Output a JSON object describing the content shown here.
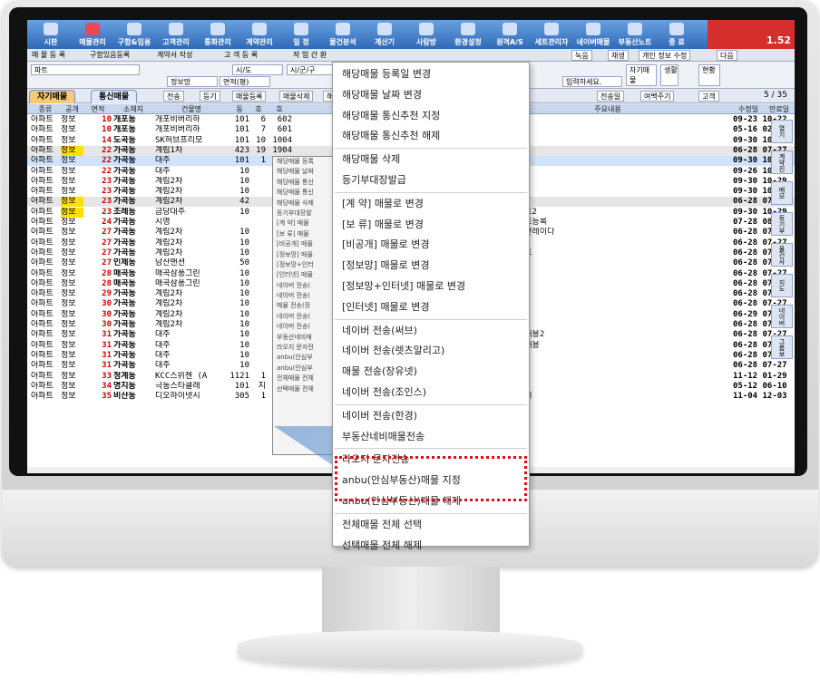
{
  "titlebar": {
    "items": [
      {
        "label": "시판"
      },
      {
        "label": "매물관리"
      },
      {
        "label": "구함&임용"
      },
      {
        "label": "고객관리"
      },
      {
        "label": "통화관리"
      },
      {
        "label": "계약관리"
      },
      {
        "label": "일 정"
      },
      {
        "label": "물건분석"
      },
      {
        "label": "계산기"
      },
      {
        "label": "사람방"
      },
      {
        "label": "환경설정"
      },
      {
        "label": "원격A/S"
      },
      {
        "label": "세트관리자"
      },
      {
        "label": "네이버매물"
      },
      {
        "label": "부동산노트"
      },
      {
        "label": "종 료"
      }
    ],
    "right_text": "1.52"
  },
  "toolbar1": {
    "items": [
      "매 물 등 록",
      "구함있음등록",
      "계약서 작성",
      "고 객 등 록",
      "작 업 간 환"
    ],
    "right_items": [
      "녹음",
      "재생",
      "개인 정보 수정",
      "다음"
    ]
  },
  "toolbar2": {
    "field1": "파트",
    "select1": "시/도",
    "select2": "시/군/구",
    "checkbox": "정보망",
    "select3": "면적(평)",
    "hint": "입력하세요.",
    "btn1": "자기매물",
    "btn2": "생활",
    "btn3": "현황"
  },
  "tabs": [
    {
      "label": "자기매물"
    },
    {
      "label": "통신매물"
    }
  ],
  "toolbar3": {
    "items": [
      "전송",
      "등기",
      "매물등록",
      "매물삭제",
      "해제요"
    ],
    "right_items": [
      "전송일",
      "여백주기",
      "고객"
    ],
    "page": "5 / 35"
  },
  "table": {
    "headers": [
      "종류",
      "공개",
      "면적",
      "소재지",
      "건물명",
      "동",
      "호",
      "호",
      "주요내용",
      "수정일",
      "만료일"
    ],
    "rows": [
      {
        "type": "아파트",
        "kind": "정보",
        "area": "10",
        "loc": "개포동",
        "bld": "개포비버리하",
        "dong": "101",
        "ho": "6",
        "unit": "602",
        "desc": "",
        "date": "09-23 10-22"
      },
      {
        "type": "아파트",
        "kind": "정보",
        "area": "10",
        "loc": "개포동",
        "bld": "개포비버리하",
        "dong": "101",
        "ho": "7",
        "unit": "601",
        "desc": "",
        "date": "05-16 02-10"
      },
      {
        "type": "아파트",
        "kind": "정보",
        "area": "14",
        "loc": "도곡동",
        "bld": "SK허브프리모",
        "dong": "101",
        "ho": "10",
        "unit": "1004",
        "desc": "",
        "date": "09-30 10-29"
      },
      {
        "type": "아파트",
        "kind": "정보",
        "area": "22",
        "loc": "가곡동",
        "bld": "계림1차",
        "dong": "423",
        "ho": "19",
        "unit": "1904",
        "desc": "",
        "date": "06-28 07-27"
      },
      {
        "type": "아파트",
        "kind": "정보",
        "area": "22",
        "loc": "가곡동",
        "bld": "대주",
        "dong": "101",
        "ho": "1",
        "unit": "101",
        "desc": "",
        "date": "09-30 10-29"
      },
      {
        "type": "아파트",
        "kind": "정보",
        "area": "22",
        "loc": "가곡동",
        "bld": "대주",
        "dong": "10",
        "ho": "",
        "unit": "",
        "desc": "",
        "date": "09-26 10-25"
      },
      {
        "type": "아파트",
        "kind": "정보",
        "area": "23",
        "loc": "가곡동",
        "bld": "계림2차",
        "dong": "10",
        "ho": "",
        "unit": "",
        "desc": "",
        "date": "09-30 10-29"
      },
      {
        "type": "아파트",
        "kind": "정보",
        "area": "23",
        "loc": "가곡동",
        "bld": "계림2차",
        "dong": "10",
        "ho": "",
        "unit": "",
        "desc": "",
        "date": "09-30 10-29"
      },
      {
        "type": "아파트",
        "kind": "정보",
        "area": "23",
        "loc": "가곡동",
        "bld": "계림2차",
        "dong": "42",
        "ho": "",
        "unit": "",
        "desc": "",
        "date": "06-28 07-27"
      },
      {
        "type": "아파트",
        "kind": "정보",
        "area": "23",
        "loc": "조례동",
        "bld": "금당대주",
        "dong": "10",
        "ho": "",
        "unit": "",
        "desc": "스트2",
        "date": "09-30 10-29"
      },
      {
        "type": "아파트",
        "kind": "정보",
        "area": "24",
        "loc": "가곡동",
        "bld": "시영",
        "dong": "",
        "ho": "",
        "unit": "",
        "desc": "스트등록",
        "date": "07-28 08-26"
      },
      {
        "type": "아파트",
        "kind": "정보",
        "area": "27",
        "loc": "가곡동",
        "bld": "계림2차",
        "dong": "10",
        "ho": "",
        "unit": "",
        "desc": "동산레이다",
        "date": "06-28 07-27"
      },
      {
        "type": "아파트",
        "kind": "정보",
        "area": "27",
        "loc": "가곡동",
        "bld": "계림2차",
        "dong": "10",
        "ho": "",
        "unit": "",
        "desc": "",
        "date": "06-28 07-27"
      },
      {
        "type": "아파트",
        "kind": "정보",
        "area": "27",
        "loc": "가곡동",
        "bld": "계림2차",
        "dong": "10",
        "ho": "",
        "unit": "",
        "desc": "스트",
        "date": "06-28 07-27"
      },
      {
        "type": "아파트",
        "kind": "정보",
        "area": "27",
        "loc": "인제동",
        "bld": "남산맨션",
        "dong": "50",
        "ho": "",
        "unit": "",
        "desc": "",
        "date": "06-28 07-27"
      },
      {
        "type": "아파트",
        "kind": "정보",
        "area": "28",
        "loc": "매곡동",
        "bld": "매곡삼풍그린",
        "dong": "10",
        "ho": "",
        "unit": "",
        "desc": "",
        "date": "06-28 07-27"
      },
      {
        "type": "아파트",
        "kind": "정보",
        "area": "28",
        "loc": "매곡동",
        "bld": "매곡삼풍그린",
        "dong": "10",
        "ho": "",
        "unit": "",
        "desc": "",
        "date": "06-28 07-27"
      },
      {
        "type": "아파트",
        "kind": "정보",
        "area": "29",
        "loc": "가곡동",
        "bld": "계림2차",
        "dong": "10",
        "ho": "",
        "unit": "",
        "desc": "",
        "date": "06-28 07-27"
      },
      {
        "type": "아파트",
        "kind": "정보",
        "area": "30",
        "loc": "가곡동",
        "bld": "계림2차",
        "dong": "10",
        "ho": "",
        "unit": "",
        "desc": "",
        "date": "06-28 07-27"
      },
      {
        "type": "아파트",
        "kind": "정보",
        "area": "30",
        "loc": "가곡동",
        "bld": "계림2차",
        "dong": "10",
        "ho": "",
        "unit": "",
        "desc": "",
        "date": "06-29 07-28"
      },
      {
        "type": "아파트",
        "kind": "정보",
        "area": "30",
        "loc": "가곡동",
        "bld": "계림2차",
        "dong": "10",
        "ho": "",
        "unit": "",
        "desc": "",
        "date": "06-28 07-27"
      },
      {
        "type": "아파트",
        "kind": "정보",
        "area": "31",
        "loc": "가곡동",
        "bld": "대주",
        "dong": "10",
        "ho": "",
        "unit": "",
        "desc": "요내용2",
        "date": "06-28 07-27"
      },
      {
        "type": "아파트",
        "kind": "정보",
        "area": "31",
        "loc": "가곡동",
        "bld": "대주",
        "dong": "10",
        "ho": "",
        "unit": "",
        "desc": "요내용",
        "date": "06-28 07-27"
      },
      {
        "type": "아파트",
        "kind": "정보",
        "area": "31",
        "loc": "가곡동",
        "bld": "대주",
        "dong": "10",
        "ho": "",
        "unit": "",
        "desc": "",
        "date": "06-28 07-27"
      },
      {
        "type": "아파트",
        "kind": "정보",
        "area": "31",
        "loc": "가곡동",
        "bld": "대주",
        "dong": "10",
        "ho": "",
        "unit": "",
        "desc": "",
        "date": "06-28 07-27"
      },
      {
        "type": "아파트",
        "kind": "정보",
        "area": "33",
        "loc": "청계동",
        "bld": "KCC스위첸 (A",
        "dong": "1121",
        "ho": "1",
        "unit": "101",
        "desc": "",
        "date": "11-12 01-29"
      },
      {
        "type": "아파트",
        "kind": "정보",
        "area": "34",
        "loc": "명지동",
        "bld": "극동스타클래",
        "dong": "101",
        "ho": "지",
        "unit": "102",
        "desc": "",
        "date": "05-12 06-10"
      },
      {
        "type": "아파트",
        "kind": "정보",
        "area": "35",
        "loc": "비산동",
        "bld": "디오하이넷시",
        "dong": "305",
        "ho": "1",
        "unit": "101",
        "desc": "앙시",
        "date": "11-04 12-03"
      }
    ]
  },
  "small_menu": {
    "items": [
      "해당매물 등록",
      "해당매물 날짜",
      "해당매물 통신",
      "해당매물 통신",
      "해당매물 삭제",
      "등기부대장발",
      "[계 약] 매물",
      "[보 류] 매물",
      "[비공개] 매물",
      "[정보망] 매물",
      "[정보망+인터",
      "[인터넷] 매물",
      "네이버 전송(",
      "네이버 전송(",
      "매물 전송(장",
      "네이버 전송(",
      "네이버 전송(",
      "부동산네비매",
      "라오지 문자전",
      "anbu(안심부",
      "anbu(안심부",
      "전체매물 전체",
      "선택매물 전체"
    ]
  },
  "context_menu": {
    "items": [
      "해당매물 등록일 변경",
      "해당매물 날짜 변경",
      "해당매물 통신추천 지정",
      "해당매물 통신추천 해제",
      "해당매물 삭제",
      "등기부대장발급",
      "[계   약] 매물로 변경",
      "[보   류] 매물로 변경",
      "[비공개] 매물로 변경",
      "[정보망] 매물로 변경",
      "[정보망+인터넷] 매물로 변경",
      "[인터넷] 매물로 변경",
      "네이버 전송(써브)",
      "네이버 전송(렛츠알리고)",
      "매물 전송(장유넷)",
      "네이버 전송(조인스)",
      "네이버 전송(한경)",
      "부동산네비매물전송",
      "라오지 문자전송",
      "anbu(안심부동산)매물 지정",
      "anbu(안심부동산)매물 해제",
      "전체매물 전체 선택",
      "선택매물 전체 해제"
    ]
  },
  "sidebar": {
    "items": [
      "열기",
      "계약진행",
      "메모",
      "등기부등본",
      "물건사진",
      "지도",
      "네이버전송",
      "그룹보기"
    ]
  },
  "colors": {
    "titlebar": "#2f6ab8",
    "highlight_box": "#e01010",
    "area_text": "#d00000",
    "tab_active": "#f7c87a"
  }
}
